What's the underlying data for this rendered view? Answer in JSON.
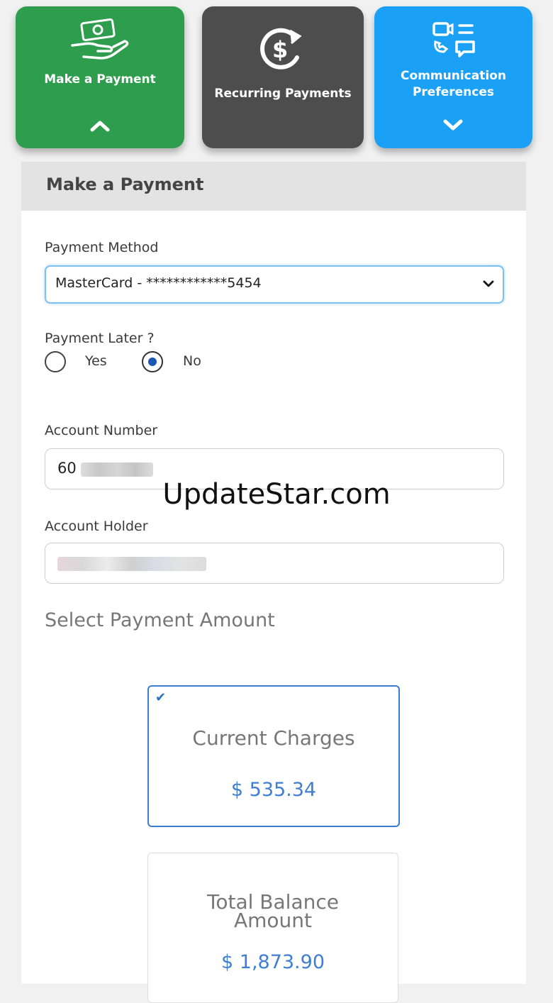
{
  "tiles": {
    "make_payment": {
      "label": "Make a Payment",
      "color": "#2e9d4e"
    },
    "recurring": {
      "label": "Recurring Payments",
      "color": "#4d4d4d"
    },
    "communication": {
      "label_line1": "Communication",
      "label_line2": "Preferences",
      "color": "#1aa0f5"
    }
  },
  "panel": {
    "title": "Make a Payment"
  },
  "payment_method": {
    "label": "Payment Method",
    "selected": "MasterCard - ************5454"
  },
  "payment_later": {
    "label": "Payment Later ?",
    "options": [
      "Yes",
      "No"
    ],
    "selected": "No"
  },
  "account_number": {
    "label": "Account Number",
    "value": "60"
  },
  "account_holder": {
    "label": "Account Holder"
  },
  "watermark": "UpdateStar.com",
  "amount_section": {
    "title": "Select Payment Amount",
    "cards": [
      {
        "title": "Current Charges",
        "amount": "$ 535.34",
        "selected": true
      },
      {
        "title_line1": "Total Balance",
        "title_line2": "Amount",
        "amount": "$ 1,873.90",
        "selected": false
      }
    ]
  }
}
